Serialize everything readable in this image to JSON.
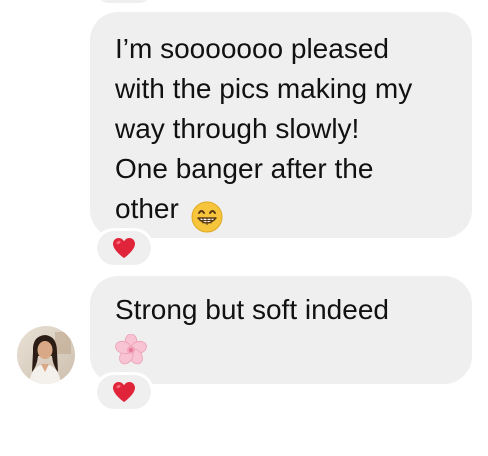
{
  "messages": [
    {
      "lines": [
        "I’m sooooooo pleased",
        "with the pics making my",
        "way through slowly!",
        "One banger after the",
        "other"
      ],
      "trailing_emoji": "grinning-face-with-big-eyes-emoji",
      "reaction": "red-heart-emoji"
    },
    {
      "lines": [
        "Strong but soft indeed"
      ],
      "trailing_emoji": "cherry-blossom-emoji",
      "reaction": "red-heart-emoji"
    }
  ],
  "colors": {
    "bubble": "#efefef",
    "text": "#111111",
    "heart": "#e0243a"
  }
}
